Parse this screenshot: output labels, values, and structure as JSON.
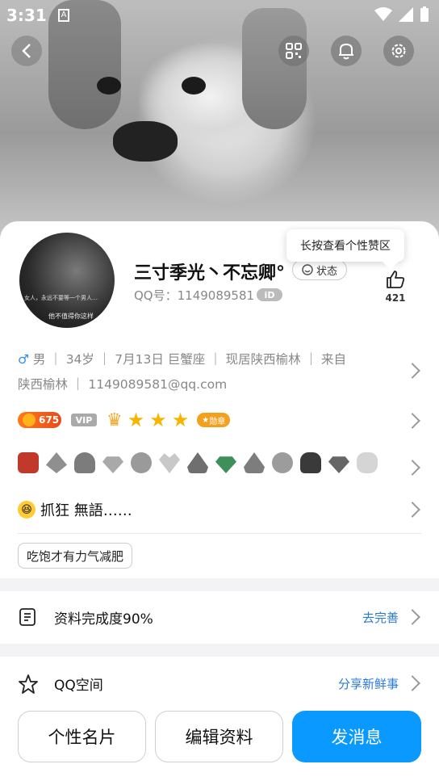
{
  "status_bar": {
    "time": "3:31",
    "notif_letter": "A"
  },
  "profile": {
    "name": "三寸季光丶不忘卿°",
    "state_label": "状态",
    "qq_label": "QQ号：1149089581",
    "id_badge": "iD",
    "avatar_text_1": "女人，永远不要等一个男人…",
    "avatar_text_2": "他不值得你这样",
    "like_tip": "长按查看个性赞区",
    "like_count": "421"
  },
  "info": {
    "gender_symbol": "♂",
    "line1": "男 ｜ 34岁 ｜ 7月13日  巨蟹座 ｜ 现居陕西榆林 ｜ 来自",
    "line2": "陕西榆林 ｜ 1149089581@qq.com"
  },
  "badges": {
    "level": "675",
    "vip": "VIP",
    "medal": "勋章"
  },
  "signature": "抓狂 無語……",
  "tag": "吃饱才有力气减肥",
  "list": [
    {
      "label": "资料完成度90%",
      "action": "去完善"
    },
    {
      "label": "QQ空间",
      "action": "分享新鲜事"
    }
  ],
  "buttons": {
    "card": "个性名片",
    "edit": "编辑资料",
    "message": "发消息"
  },
  "colors": {
    "accent": "#0a99ff",
    "link": "#2a79d8",
    "male": "#2f8ce8"
  }
}
